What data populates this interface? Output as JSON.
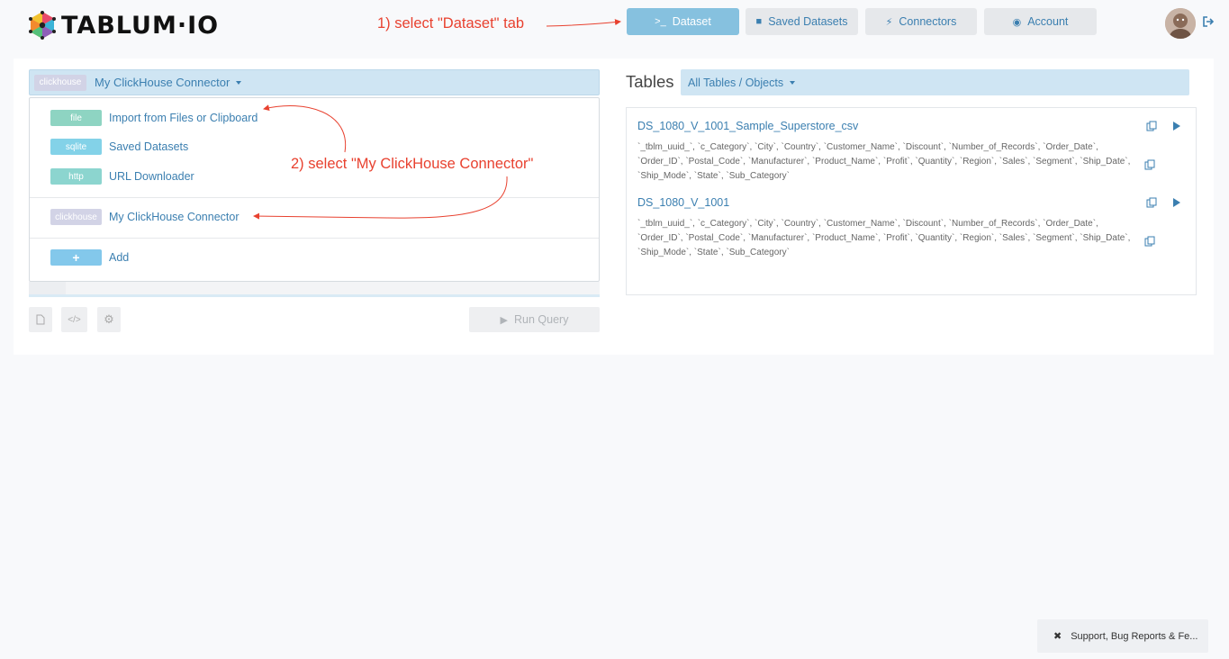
{
  "header": {
    "logo_text": "TABLUM·IO",
    "tabs": [
      {
        "label": "Dataset",
        "icon": "terminal-icon",
        "active": true
      },
      {
        "label": "Saved Datasets",
        "icon": "archive-icon",
        "active": false
      },
      {
        "label": "Connectors",
        "icon": "plug-icon",
        "active": false
      },
      {
        "label": "Account",
        "icon": "user-circle-icon",
        "active": false
      }
    ]
  },
  "annotations": {
    "step1": "1) select \"Dataset\" tab",
    "step2": "2) select \"My ClickHouse Connector\""
  },
  "connector": {
    "selected_tag": "clickhouse",
    "selected_label": "My ClickHouse Connector",
    "items": [
      {
        "tag": "file",
        "label": "Import from Files or Clipboard"
      },
      {
        "tag": "sqlite",
        "label": "Saved Datasets"
      },
      {
        "tag": "http",
        "label": "URL Downloader"
      },
      {
        "tag": "clickhouse",
        "label": "My ClickHouse Connector"
      },
      {
        "tag": "+",
        "label": "Add"
      }
    ]
  },
  "toolbar": {
    "run_label": "Run Query"
  },
  "tables": {
    "title": "Tables",
    "filter_label": "All Tables / Objects",
    "items": [
      {
        "name": "DS_1080_V_1001_Sample_Superstore_csv",
        "columns_line1": "`_tblm_uuid_`, `c_Category`, `City`, `Country`, `Customer_Name`, `Discount`, `Number_of_Records`, `Order_Date`,",
        "columns_line2": "`Order_ID`, `Postal_Code`, `Manufacturer`, `Product_Name`, `Profit`, `Quantity`, `Region`, `Sales`, `Segment`, `Ship_Date`,",
        "columns_line3": "`Ship_Mode`, `State`, `Sub_Category`"
      },
      {
        "name": "DS_1080_V_1001",
        "columns_line1": "`_tblm_uuid_`, `c_Category`, `City`, `Country`, `Customer_Name`, `Discount`, `Number_of_Records`, `Order_Date`,",
        "columns_line2": "`Order_ID`, `Postal_Code`, `Manufacturer`, `Product_Name`, `Profit`, `Quantity`, `Region`, `Sales`, `Segment`, `Ship_Date`,",
        "columns_line3": "`Ship_Mode`, `State`, `Sub_Category`"
      }
    ]
  },
  "support": {
    "label": "Support, Bug Reports & Fe..."
  },
  "colors": {
    "accent": "#3b7fb0",
    "active_tab": "#86c1df",
    "annotation": "#e8412f"
  }
}
